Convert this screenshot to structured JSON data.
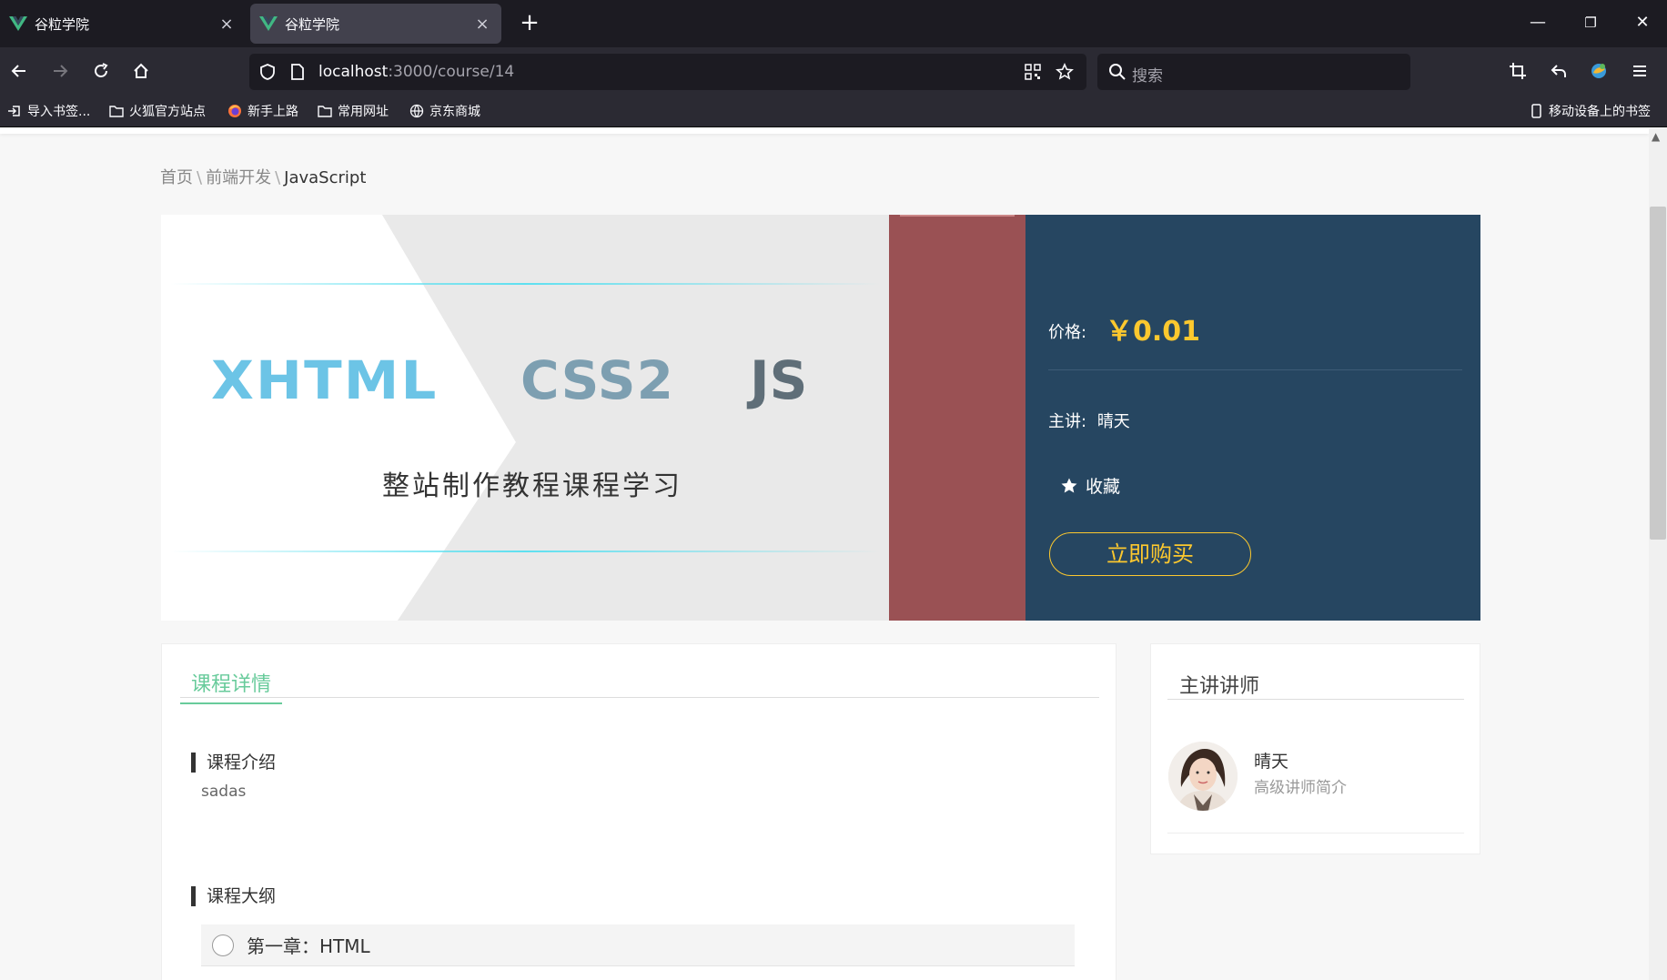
{
  "browser": {
    "tabs": [
      {
        "title": "谷粒学院",
        "active": false
      },
      {
        "title": "谷粒学院",
        "active": true
      }
    ],
    "url_host": "localhost",
    "url_path": ":3000/course/14",
    "search_placeholder": "搜索",
    "bookmarks": [
      "导入书签...",
      "火狐官方站点",
      "新手上路",
      "常用网址",
      "京东商城"
    ],
    "mobile_bookmarks": "移动设备上的书签"
  },
  "breadcrumb": {
    "home": "首页",
    "category": "前端开发",
    "current": "JavaScript",
    "separator": "\\"
  },
  "course": {
    "cover": {
      "word1": "XHTML",
      "word2": "CSS2",
      "word3": "JS",
      "subtitle": "整站制作教程课程学习"
    },
    "price_label": "价格:",
    "price": "￥0.01",
    "teacher_label": "主讲:",
    "teacher_name": "晴天",
    "favorite_label": "收藏",
    "buy_label": "立即购买"
  },
  "detail": {
    "tab_label": "课程详情",
    "intro_title": "课程介绍",
    "intro_text": "sadas",
    "outline_title": "课程大纲",
    "chapters": [
      "第一章：HTML"
    ]
  },
  "teacher_panel": {
    "title": "主讲讲师",
    "name": "晴天",
    "intro": "高级讲师简介"
  },
  "colors": {
    "info_bg": "#264661",
    "accent_red": "#9a5154",
    "price_yellow": "#fcc82e",
    "tab_green": "#68cb9b"
  }
}
